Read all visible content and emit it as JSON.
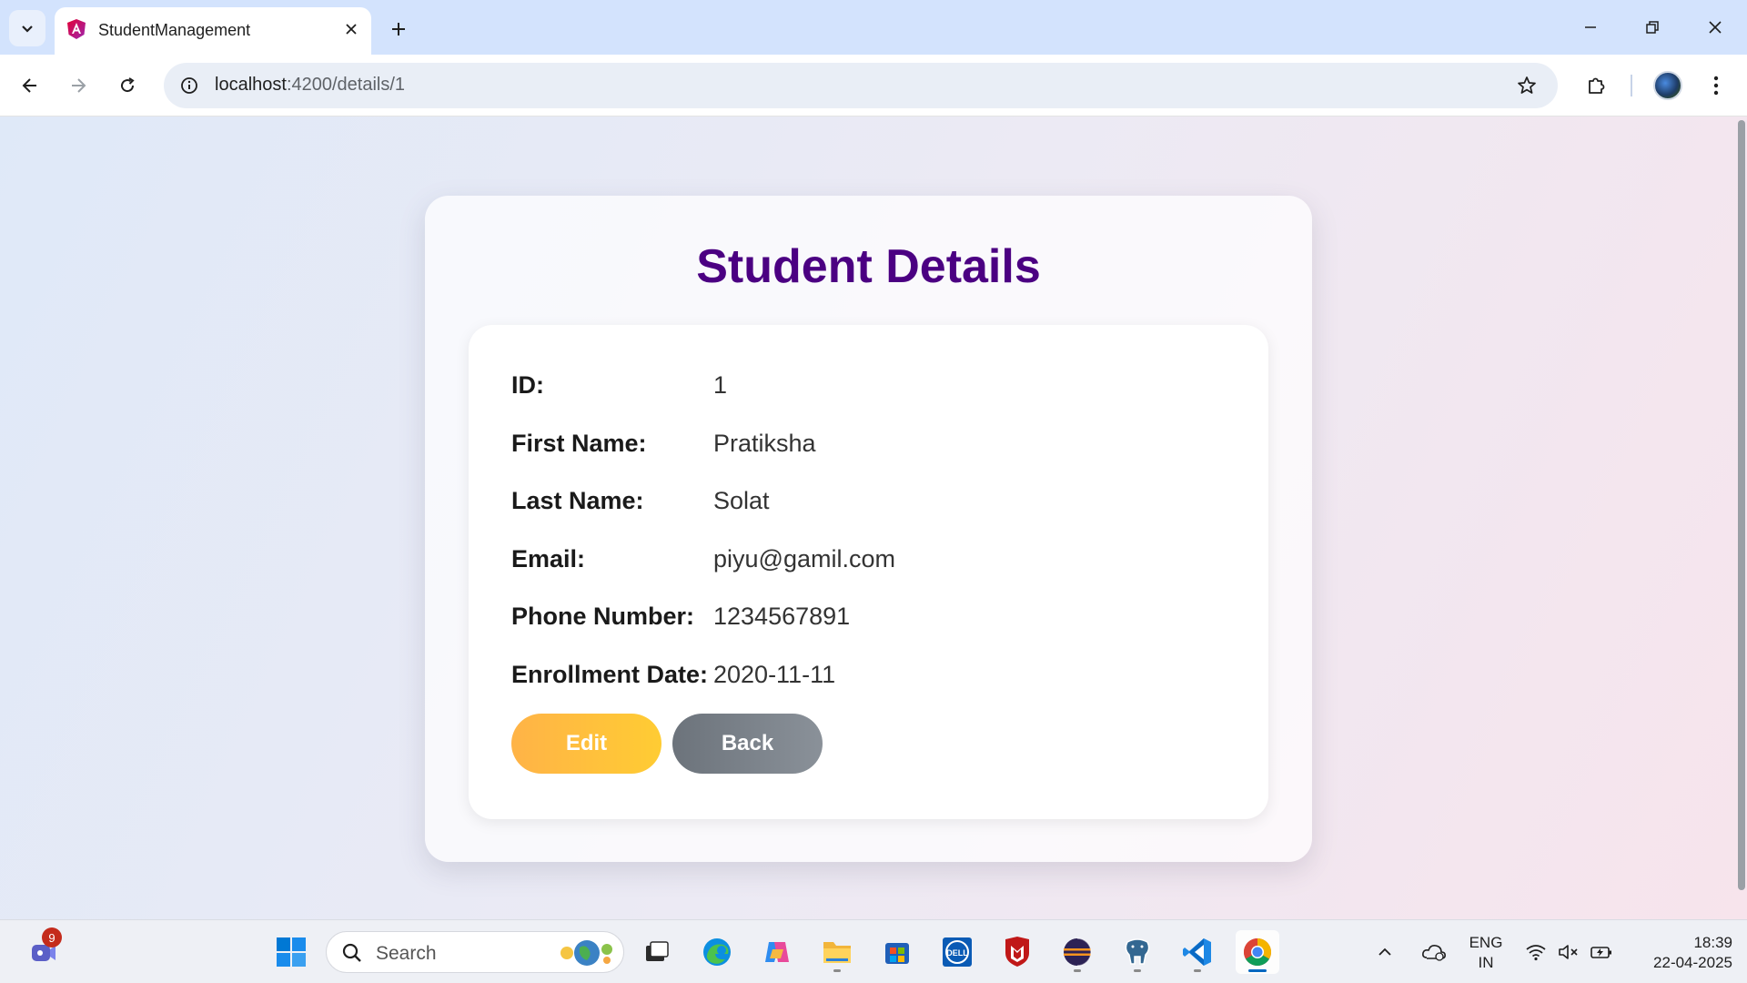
{
  "browser": {
    "tab_title": "StudentManagement",
    "url_host": "localhost",
    "url_path": ":4200/details/1"
  },
  "page": {
    "title": "Student Details",
    "fields": [
      {
        "label": "ID:",
        "value": "1"
      },
      {
        "label": "First Name:",
        "value": "Pratiksha"
      },
      {
        "label": "Last Name:",
        "value": "Solat"
      },
      {
        "label": "Email:",
        "value": "piyu@gamil.com"
      },
      {
        "label": "Phone Number:",
        "value": "1234567891"
      },
      {
        "label": "Enrollment Date:",
        "value": "2020-11-11"
      }
    ],
    "buttons": {
      "edit": "Edit",
      "back": "Back"
    }
  },
  "taskbar": {
    "search_placeholder": "Search",
    "teams_badge": "9",
    "language_line1": "ENG",
    "language_line2": "IN",
    "time": "18:39",
    "date": "22-04-2025"
  },
  "colors": {
    "title": "#4b0082",
    "edit_button": "#ffbe3d",
    "back_button": "#7a8189",
    "chrome_tabbar": "#d3e3fd"
  }
}
